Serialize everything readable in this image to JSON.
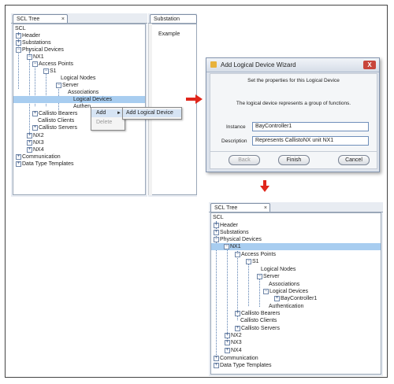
{
  "top_left_pane": {
    "tab_label": "SCL Tree",
    "tab_close": "×",
    "second_tab_label": "Substation",
    "second_pane_text": "Example",
    "tree": {
      "root": "SCL",
      "header": "Header",
      "substations": "Substations",
      "physical_devices": "Physical Devices",
      "nx1": "NX1",
      "access_points": "Access Points",
      "s1": "S1",
      "logical_nodes": "Logical Nodes",
      "server": "Server",
      "associations": "Associations",
      "logical_devices": "Logical Devices",
      "authentication": "Authen",
      "callisto_bearers": "Callisto Bearers",
      "callisto_clients": "Callisto Clients",
      "callisto_servers": "Callisto Servers",
      "nx2": "NX2",
      "nx3": "NX3",
      "nx4": "NX4",
      "communication": "Communication",
      "data_type_templates": "Data Type Templates"
    }
  },
  "context_menu": {
    "add": "Add",
    "add_arrow": "►",
    "delete": "Delete",
    "submenu_item": "Add Logical Device"
  },
  "wizard": {
    "title": "Add Logical Device Wizard",
    "close": "X",
    "subtitle": "Set the properties for this Logical Device",
    "description_text": "The logical device represents a group of functions.",
    "instance_label": "Instance",
    "instance_value": "BayController1",
    "description_label": "Description",
    "description_value": "Represents CallistoNX unit NX1",
    "back_label": "Back",
    "finish_label": "Finish",
    "cancel_label": "Cancel"
  },
  "bottom_pane": {
    "tab_label": "SCL Tree",
    "tab_close": "×",
    "tree": {
      "root": "SCL",
      "header": "Header",
      "substations": "Substations",
      "physical_devices": "Physical Devices",
      "nx1": "NX1",
      "access_points": "Access Points",
      "s1": "S1",
      "logical_nodes": "Logical Nodes",
      "server": "Server",
      "associations": "Associations",
      "logical_devices": "Logical Devices",
      "bay_controller": "BayController1",
      "authentication": "Authentication",
      "callisto_bearers": "Callisto Bearers",
      "callisto_clients": "Callisto Clients",
      "callisto_servers": "Callisto Servers",
      "nx2": "NX2",
      "nx3": "NX3",
      "nx4": "NX4",
      "communication": "Communication",
      "data_type_templates": "Data Type Templates"
    }
  },
  "colors": {
    "selection": "#a8cdf0",
    "arrow": "#e0261b",
    "close_button": "#c8453b"
  }
}
